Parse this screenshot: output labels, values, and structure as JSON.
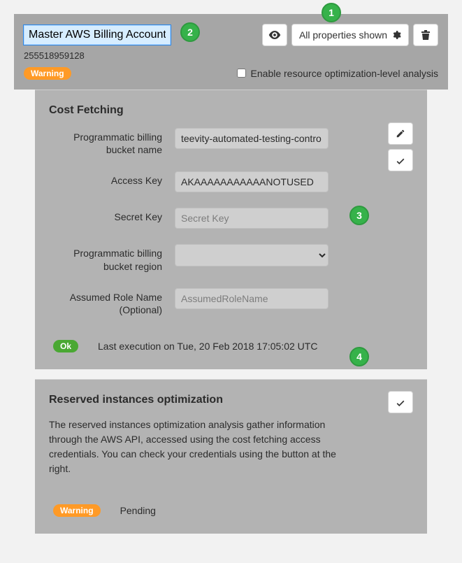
{
  "header": {
    "title_value": "Master AWS Billing Account",
    "account_id": "255518959128",
    "warning_badge": "Warning",
    "properties_button": "All properties shown",
    "enable_checkbox_label": "Enable resource optimization-level analysis",
    "enable_checked": false
  },
  "icons": {
    "eye": "eye-icon",
    "gear": "gear-icon",
    "trash": "trash-icon",
    "pencil": "pencil-icon",
    "check": "check-icon"
  },
  "callouts": {
    "c1": "1",
    "c2": "2",
    "c3": "3",
    "c4": "4"
  },
  "cost_fetching": {
    "title": "Cost Fetching",
    "bucket_name_label": "Programmatic billing bucket name",
    "bucket_name_value": "teevity-automated-testing-contro",
    "access_key_label": "Access Key",
    "access_key_value": "AKAAAAAAAAAAANOTUSED",
    "secret_key_label": "Secret Key",
    "secret_key_placeholder": "Secret Key",
    "bucket_region_label": "Programmatic billing bucket region",
    "bucket_region_value": "",
    "assumed_role_label": "Assumed Role Name (Optional)",
    "assumed_role_placeholder": "AssumedRoleName",
    "status_badge": "Ok",
    "status_text": "Last execution on Tue, 20 Feb 2018 17:05:02 UTC"
  },
  "ri_opt": {
    "title": "Reserved instances optimization",
    "description": "The reserved instances optimization analysis gather information through the AWS API, accessed using the cost fetching access credentials. You can check your credentials using the button at the right.",
    "status_badge": "Warning",
    "status_text": "Pending"
  }
}
